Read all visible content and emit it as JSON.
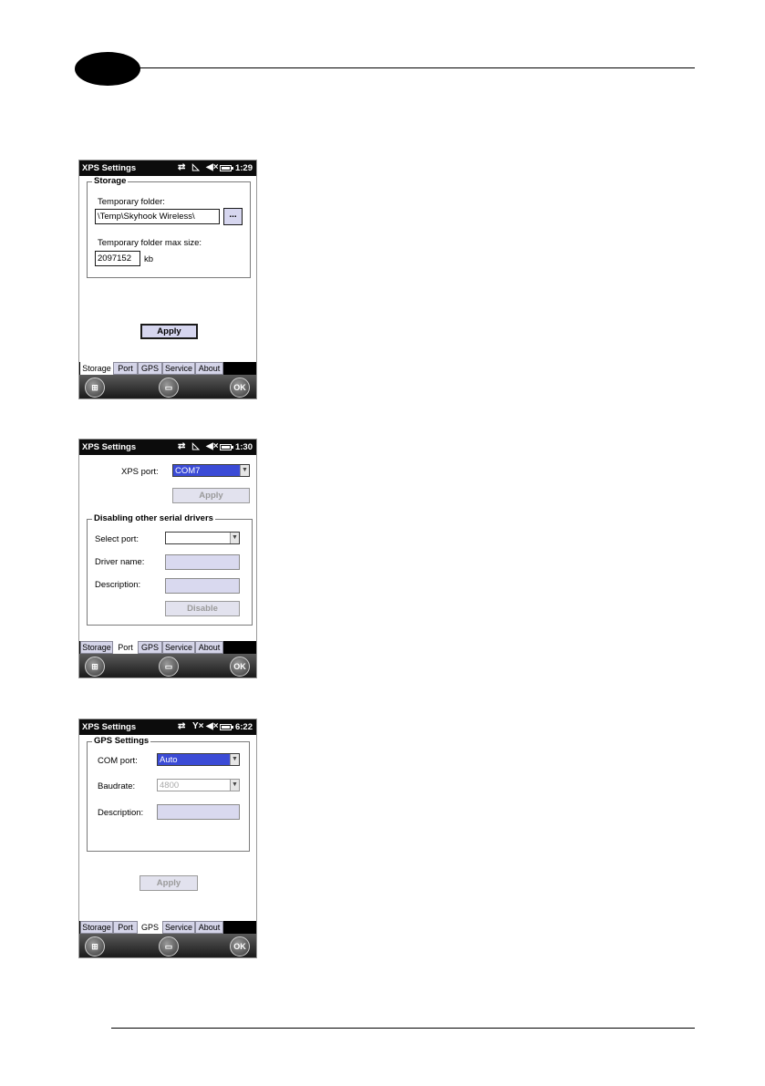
{
  "screens": [
    {
      "title": "XPS Settings",
      "time": "1:29",
      "storage": {
        "group_title": "Storage",
        "temp_folder_label": "Temporary folder:",
        "temp_folder_value": "\\Temp\\Skyhook Wireless\\",
        "browse_label": "...",
        "max_size_label": "Temporary folder max size:",
        "max_size_value": "2097152",
        "unit": "kb",
        "apply_label": "Apply"
      },
      "tabs": [
        "Storage",
        "Port",
        "GPS",
        "Service",
        "About"
      ],
      "active_tab": "Storage",
      "softkeys": {
        "ok": "OK"
      }
    },
    {
      "title": "XPS Settings",
      "time": "1:30",
      "port": {
        "xps_port_label": "XPS port:",
        "xps_port_value": "COM7",
        "apply_label": "Apply",
        "group_title": "Disabling other serial drivers",
        "select_port_label": "Select port:",
        "select_port_value": "",
        "driver_name_label": "Driver name:",
        "description_label": "Description:",
        "disable_label": "Disable"
      },
      "tabs": [
        "Storage",
        "Port",
        "GPS",
        "Service",
        "About"
      ],
      "active_tab": "Port",
      "softkeys": {
        "ok": "OK"
      }
    },
    {
      "title": "XPS Settings",
      "time": "6:22",
      "gps": {
        "group_title": "GPS Settings",
        "com_port_label": "COM port:",
        "com_port_value": "Auto",
        "baudrate_label": "Baudrate:",
        "baudrate_value": "4800",
        "description_label": "Description:",
        "apply_label": "Apply"
      },
      "tabs": [
        "Storage",
        "Port",
        "GPS",
        "Service",
        "About"
      ],
      "active_tab": "GPS",
      "softkeys": {
        "ok": "OK"
      }
    }
  ],
  "icons": {
    "connectivity": "connectivity-icon",
    "signal": "signal-icon",
    "volume": "volume-muted-icon",
    "battery": "battery-icon",
    "start": "windows-start-icon",
    "keyboard": "keyboard-icon"
  }
}
